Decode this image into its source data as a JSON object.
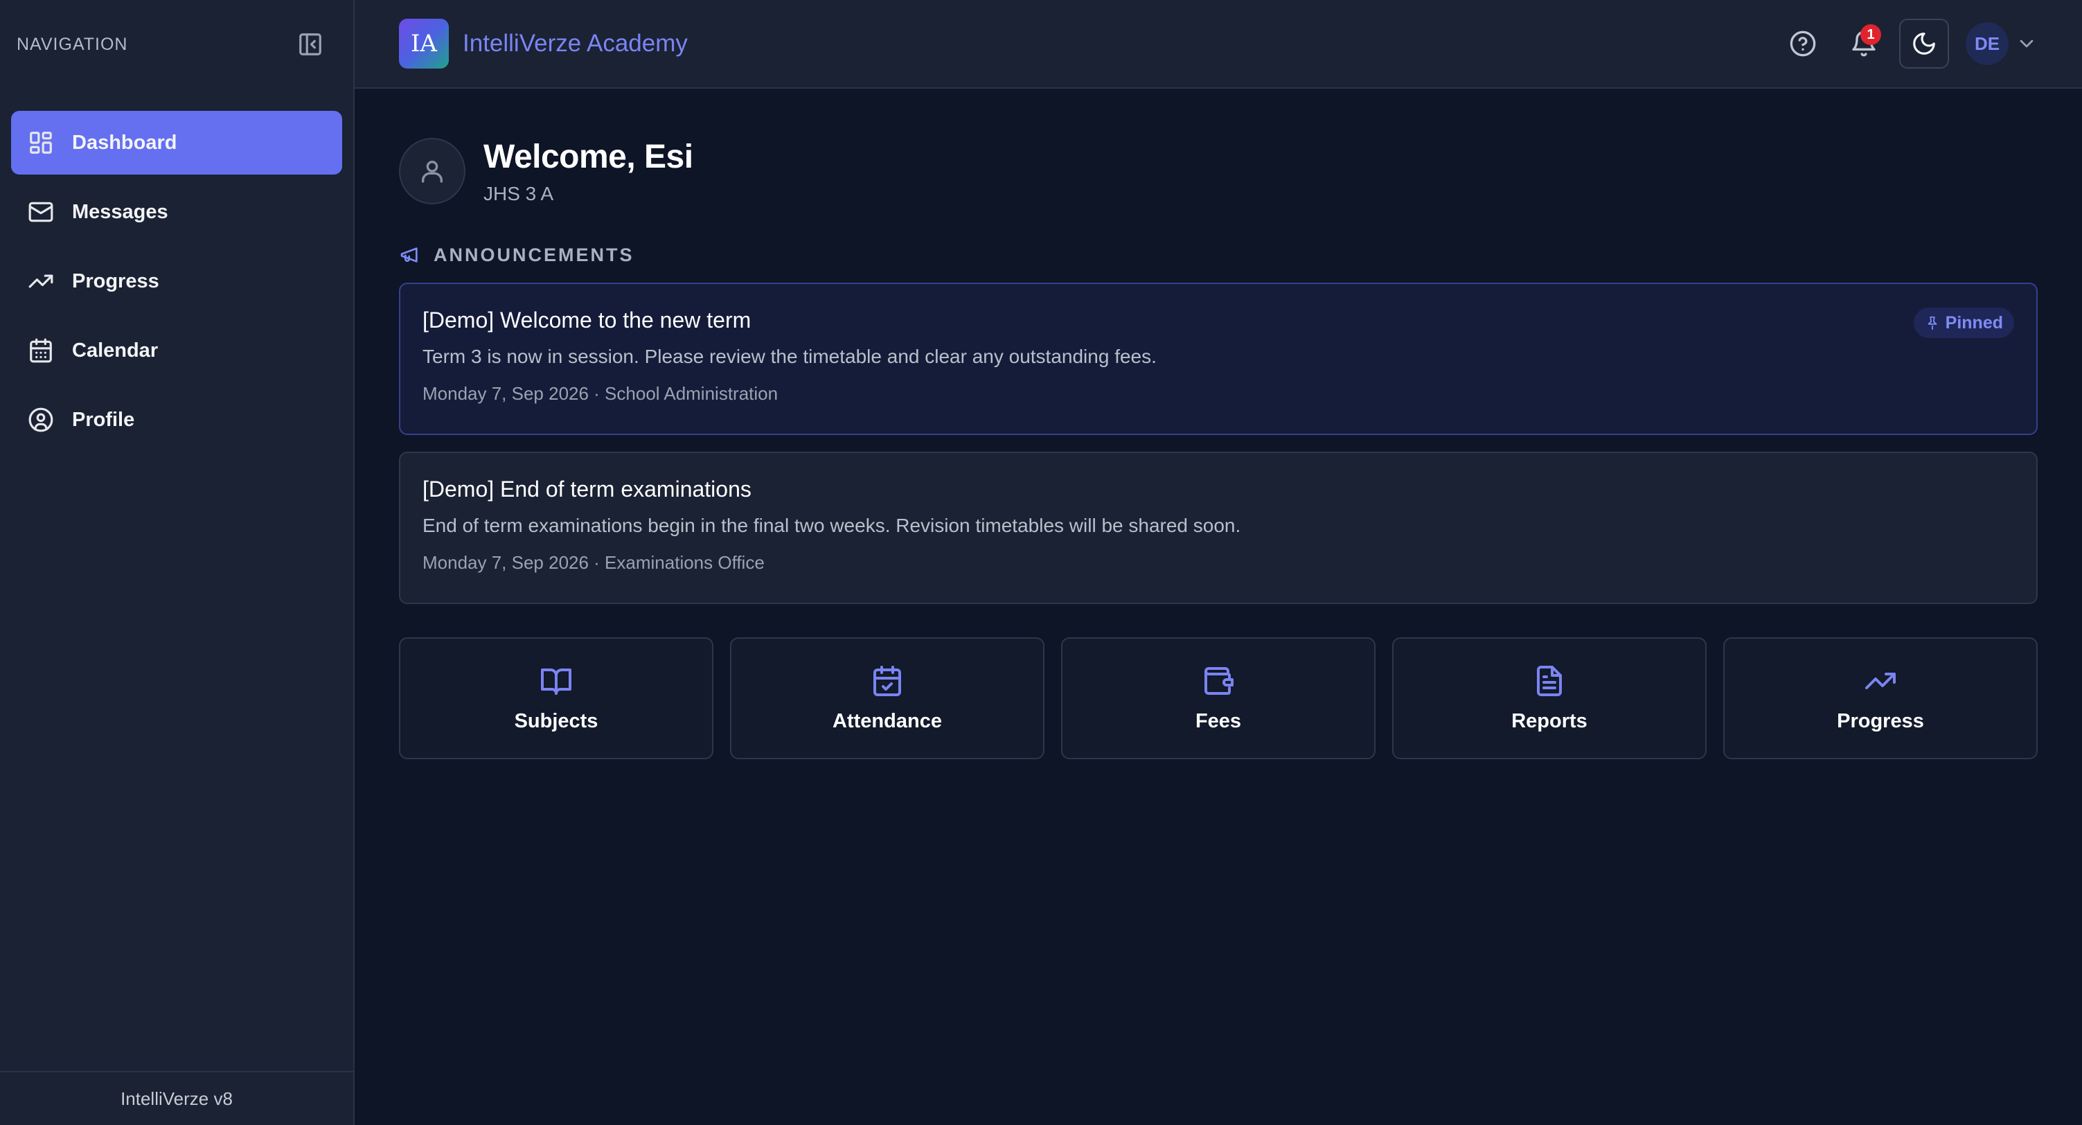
{
  "sidebar": {
    "title": "NAVIGATION",
    "items": [
      {
        "label": "Dashboard",
        "icon": "dashboard-icon",
        "active": true
      },
      {
        "label": "Messages",
        "icon": "mail-icon"
      },
      {
        "label": "Progress",
        "icon": "trending-up-icon"
      },
      {
        "label": "Calendar",
        "icon": "calendar-icon"
      },
      {
        "label": "Profile",
        "icon": "user-circle-icon"
      }
    ],
    "footer": "IntelliVerze v8"
  },
  "header": {
    "logo_text": "IA",
    "app_name": "IntelliVerze Academy",
    "notification_count": "1",
    "avatar_initials": "DE"
  },
  "welcome": {
    "title": "Welcome, Esi",
    "class": "JHS 3 A"
  },
  "announcements": {
    "heading": "ANNOUNCEMENTS",
    "items": [
      {
        "title": "[Demo] Welcome to the new term",
        "body": "Term 3 is now in session. Please review the timetable and clear any outstanding fees.",
        "meta": "Monday 7, Sep 2026 · School Administration",
        "badge": "Pinned"
      },
      {
        "title": "[Demo] End of term examinations",
        "body": "End of term examinations begin in the final two weeks. Revision timetables will be shared soon.",
        "meta": "Monday 7, Sep 2026 · Examinations Office"
      }
    ]
  },
  "quick_links": [
    {
      "label": "Subjects",
      "icon": "book-open-icon"
    },
    {
      "label": "Attendance",
      "icon": "calendar-check-icon"
    },
    {
      "label": "Fees",
      "icon": "wallet-icon"
    },
    {
      "label": "Reports",
      "icon": "file-text-icon"
    },
    {
      "label": "Progress",
      "icon": "trending-up-icon"
    }
  ],
  "colors": {
    "accent": "#6470f0",
    "background": "#0d1526",
    "panel": "#1a2233",
    "badge": "#e0242e"
  }
}
